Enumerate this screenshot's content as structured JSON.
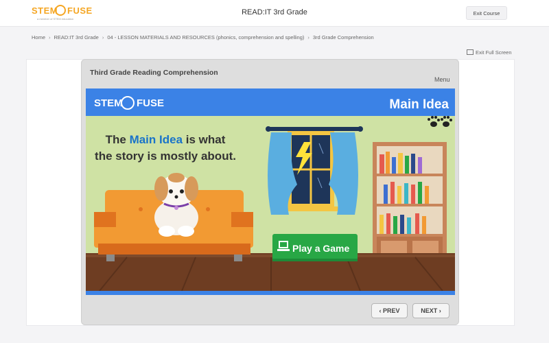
{
  "header": {
    "logo_left": "STEM",
    "logo_right": "FUSE",
    "logo_tagline": "a member of STEM education",
    "course_title": "READ:IT 3rd Grade",
    "exit_label": "Exit Course"
  },
  "breadcrumb": [
    "Home",
    "READ:IT 3rd Grade",
    "04 - LESSON MATERIALS AND RESOURCES (phonics, comprehension and spelling)",
    "3rd Grade Comprehension"
  ],
  "fullscreen_label": "Exit Full Screen",
  "player": {
    "title": "Third Grade Reading Comprehension",
    "menu_label": "Menu",
    "prev_label": "PREV",
    "next_label": "NEXT"
  },
  "slide": {
    "logo_left": "STEM",
    "logo_right": "FUSE",
    "heading": "Main Idea",
    "text_1": "The ",
    "text_highlight": "Main Idea",
    "text_2": " is what",
    "text_line2": "the story is mostly about.",
    "game_button": "Play a Game"
  },
  "colors": {
    "banner_blue": "#3b82e6",
    "highlight_blue": "#1a74c9",
    "wall_green": "#cfe2a4",
    "floor_brown": "#6e3d22",
    "sofa_orange": "#f29a33",
    "game_green": "#28a745",
    "logo_orange": "#f5a623"
  }
}
